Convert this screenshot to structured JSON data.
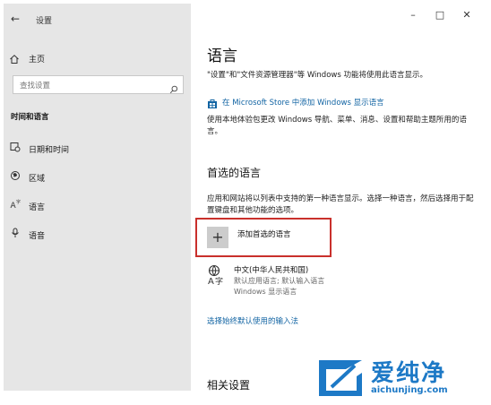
{
  "sidebar": {
    "back_glyph": "←",
    "app_title": "设置",
    "home_label": "主页",
    "search_placeholder": "查找设置",
    "section_heading": "时间和语言",
    "items": [
      {
        "label": "日期和时间",
        "icon": "calendar-clock-icon",
        "glyph": "⊡"
      },
      {
        "label": "区域",
        "icon": "globe-region-icon",
        "glyph": "❁"
      },
      {
        "label": "语言",
        "icon": "language-icon",
        "glyph": "A"
      },
      {
        "label": "语音",
        "icon": "microphone-icon",
        "glyph": "🎙"
      }
    ]
  },
  "window_controls": {
    "minimize": "–",
    "maximize": "□",
    "close": "✕"
  },
  "main": {
    "title": "语言",
    "description": "\"设置\"和\"文件资源管理器\"等 Windows 功能将使用此语言显示。",
    "store_link": "在 Microsoft Store 中添加 Windows 显示语言",
    "store_description": "使用本地体验包更改 Windows 导航、菜单、消息、设置和帮助主题所用的语言。",
    "preferred_heading": "首选的语言",
    "preferred_description": "应用和网站将以列表中支持的第一种语言显示。选择一种语言，然后选择用于配置键盘和其他功能的选项。",
    "add_language": {
      "glyph": "+",
      "label": "添加首选的语言"
    },
    "languages": [
      {
        "name": "中文(中华人民共和国)",
        "lines": [
          "默认应用语言; 默认输入语言",
          "Windows 显示语言"
        ]
      }
    ],
    "input_method_link": "选择始终默认使用的输入法",
    "related_heading": "相关设置"
  },
  "watermark": {
    "title": "爱纯净",
    "url": "aichunjing.com"
  },
  "colors": {
    "sidebar_bg": "#e6e6e6",
    "link": "#1264a3",
    "highlight": "#c9302c",
    "watermark": "#1d79c6"
  }
}
